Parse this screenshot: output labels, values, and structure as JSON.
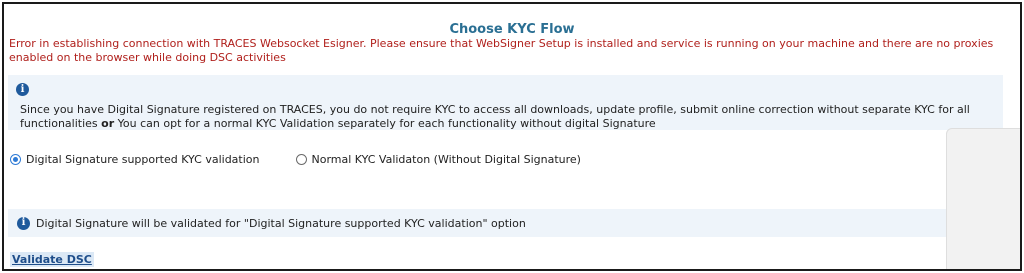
{
  "page": {
    "title": "Choose KYC Flow"
  },
  "error": {
    "message": "Error in establishing connection with TRACES Websocket Esigner. Please ensure that WebSigner Setup is installed and service is running on your machine and there are no proxies enabled on the browser while doing DSC activities"
  },
  "info": {
    "text_before": "Since you have Digital Signature registered on TRACES, you do not require KYC to access all downloads, update profile, submit online correction without separate KYC for all functionalities ",
    "text_or": "or",
    "text_after": " You can opt for a normal KYC Validation separately for each functionality without digital Signature"
  },
  "kyc_options": {
    "selected": "Digital Signature supported KYC validation",
    "option_dsc": "Digital Signature supported KYC validation",
    "option_normal": "Normal KYC Validaton (Without Digital Signature)"
  },
  "note": {
    "text": "Digital Signature will be validated for \"Digital Signature supported KYC validation\" option"
  },
  "actions": {
    "validate_dsc": "Validate DSC"
  },
  "icons": {
    "info": "info-icon",
    "info_glyph": "i"
  },
  "colors": {
    "title": "#2a6f93",
    "error": "#b0201c",
    "panel_bg": "#eef4fa",
    "info_icon": "#1f5a9c",
    "radio_selected": "#2f7bd6",
    "link": "#1e4d8a"
  }
}
